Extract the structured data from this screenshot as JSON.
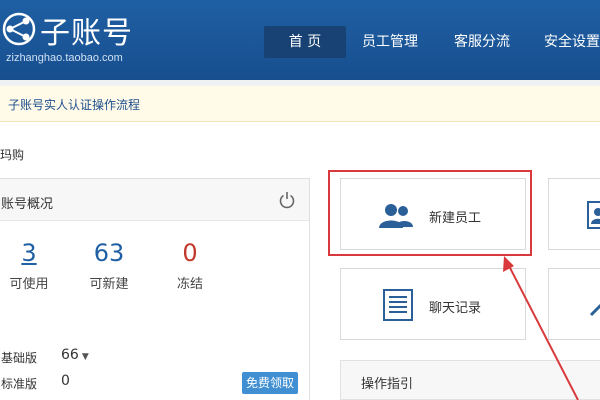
{
  "header": {
    "brand_title": "子账号",
    "brand_url": "zizhanghao.taobao.com",
    "nav": [
      {
        "label": "首 页",
        "active": true
      },
      {
        "label": "员工管理",
        "active": false
      },
      {
        "label": "客服分流",
        "active": false
      },
      {
        "label": "安全设置",
        "active": false
      }
    ]
  },
  "notice": {
    "link_text": "子账号实人认证操作流程"
  },
  "section": {
    "title": "玛购"
  },
  "account_card": {
    "title": "账号概况",
    "stats": [
      {
        "value": "3",
        "label": "可使用"
      },
      {
        "value": "63",
        "label": "可新建"
      },
      {
        "value": "0",
        "label": "冻结"
      }
    ],
    "versions": [
      {
        "label": "基础版",
        "value": "66"
      },
      {
        "label": "标准版",
        "value": "0"
      }
    ],
    "free_button": "免费领取"
  },
  "tiles": {
    "new_employee": "新建员工",
    "chat_records": "聊天记录"
  },
  "guide": {
    "title": "操作指引"
  },
  "colors": {
    "header_blue": "#1f5fa3",
    "active_nav": "#174273",
    "highlight_red": "#d9393b",
    "button_blue": "#3f8fd2"
  }
}
